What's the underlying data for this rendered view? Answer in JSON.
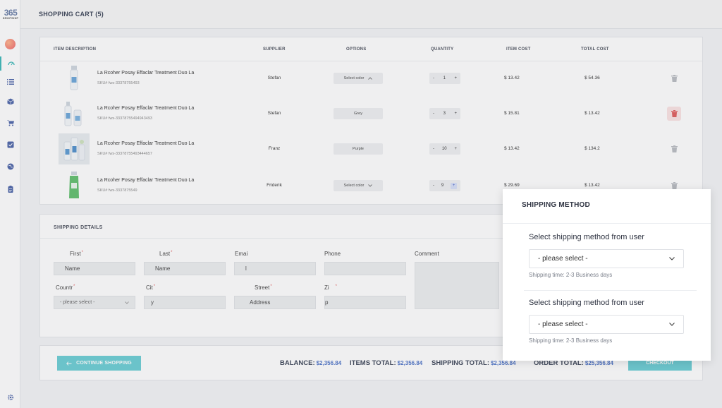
{
  "logo": {
    "big": "365",
    "small": "DROPSHIP"
  },
  "page_title": "SHOPPING CART (5)",
  "table": {
    "headers": [
      "ITEM DESCRIPTION",
      "SUPPLIER",
      "OPTIONS",
      "QUANTITY",
      "ITEM COST",
      "TOTAL COST"
    ],
    "rows": [
      {
        "name": "La Rcoher Posay Effaclar Treatment Duo La",
        "sku": "SKU# fws-33378755493",
        "supplier": "Stefan",
        "option": "Select color",
        "option_icon": "chevron-up-icon",
        "qty_minus": "-",
        "qty": "1",
        "qty_plus": "+",
        "item_cost": "$  13.42",
        "total_cost": "$  54.36",
        "delete_active": false
      },
      {
        "name": "La Rcoher Posay Effaclar Treatment Duo La",
        "sku": "SKU# fws-33378755494943493",
        "supplier": "Stefan",
        "option": "Grey",
        "option_icon": "",
        "qty_minus": "-",
        "qty": "3",
        "qty_plus": "+",
        "item_cost": "$  15.81",
        "total_cost": "$  13.42",
        "delete_active": true
      },
      {
        "name": "La Rcoher Posay Effaclar Treatment Duo La",
        "sku": "SKU# fws-33378755493444657",
        "supplier": "Franz",
        "option": "Purple",
        "option_icon": "",
        "qty_minus": "-",
        "qty": "10",
        "qty_plus": "+",
        "item_cost": "$  13.42",
        "total_cost": "$  134.2",
        "delete_active": false
      },
      {
        "name": "La Rcoher Posay Effaclar Treatment Duo La",
        "sku": "SKU# fws-3337875549",
        "supplier": "Friderik",
        "option": "Select color",
        "option_icon": "chevron-down-icon",
        "qty_minus": "-",
        "qty": "9",
        "qty_plus": "+",
        "item_cost": "$  29.69",
        "total_cost": "$  13.42",
        "delete_active": false
      }
    ]
  },
  "shipping_details": {
    "title": "SHIPPING  DETAILS",
    "first_label": "First",
    "first_value": "Name",
    "last_label": "Last",
    "last_value": "Name",
    "email_label": "Emai",
    "email_value": "l",
    "phone_label": "Phone",
    "comment_label": "Comment",
    "country_label": "Countr",
    "country_value": "- please select -",
    "city_label": "Cit",
    "city_value": "y",
    "street_label": "Street",
    "street_value": "Address",
    "zip_label": "Zi",
    "zip_value": "p",
    "required_mark": "*"
  },
  "footer": {
    "continue_label": "CONTINUE SHOPPING",
    "balance_label": "BALANCE:",
    "balance_value": "$2,356.84",
    "items_label": "ITEMS TOTAL:",
    "items_value": "$2,356.84",
    "shipping_label": "SHIPPING TOTAL:",
    "shipping_value": "$2,356.84",
    "order_label": "ORDER TOTAL:",
    "order_value": "$25,356.84",
    "checkout_label": "CHECKOUT"
  },
  "modal": {
    "title": "SHIPPING METHOD",
    "sections": [
      {
        "label": "Select shipping method from user",
        "value": "- please select -",
        "note": "Shipping time: 2-3 Business days"
      },
      {
        "label": "Select shipping method from user",
        "value": "- please select -",
        "note": "Shipping time: 2-3 Business days"
      }
    ]
  },
  "colors": {
    "accent": "#69cdd4",
    "link": "#4c72c7",
    "danger": "#e05a5a"
  }
}
